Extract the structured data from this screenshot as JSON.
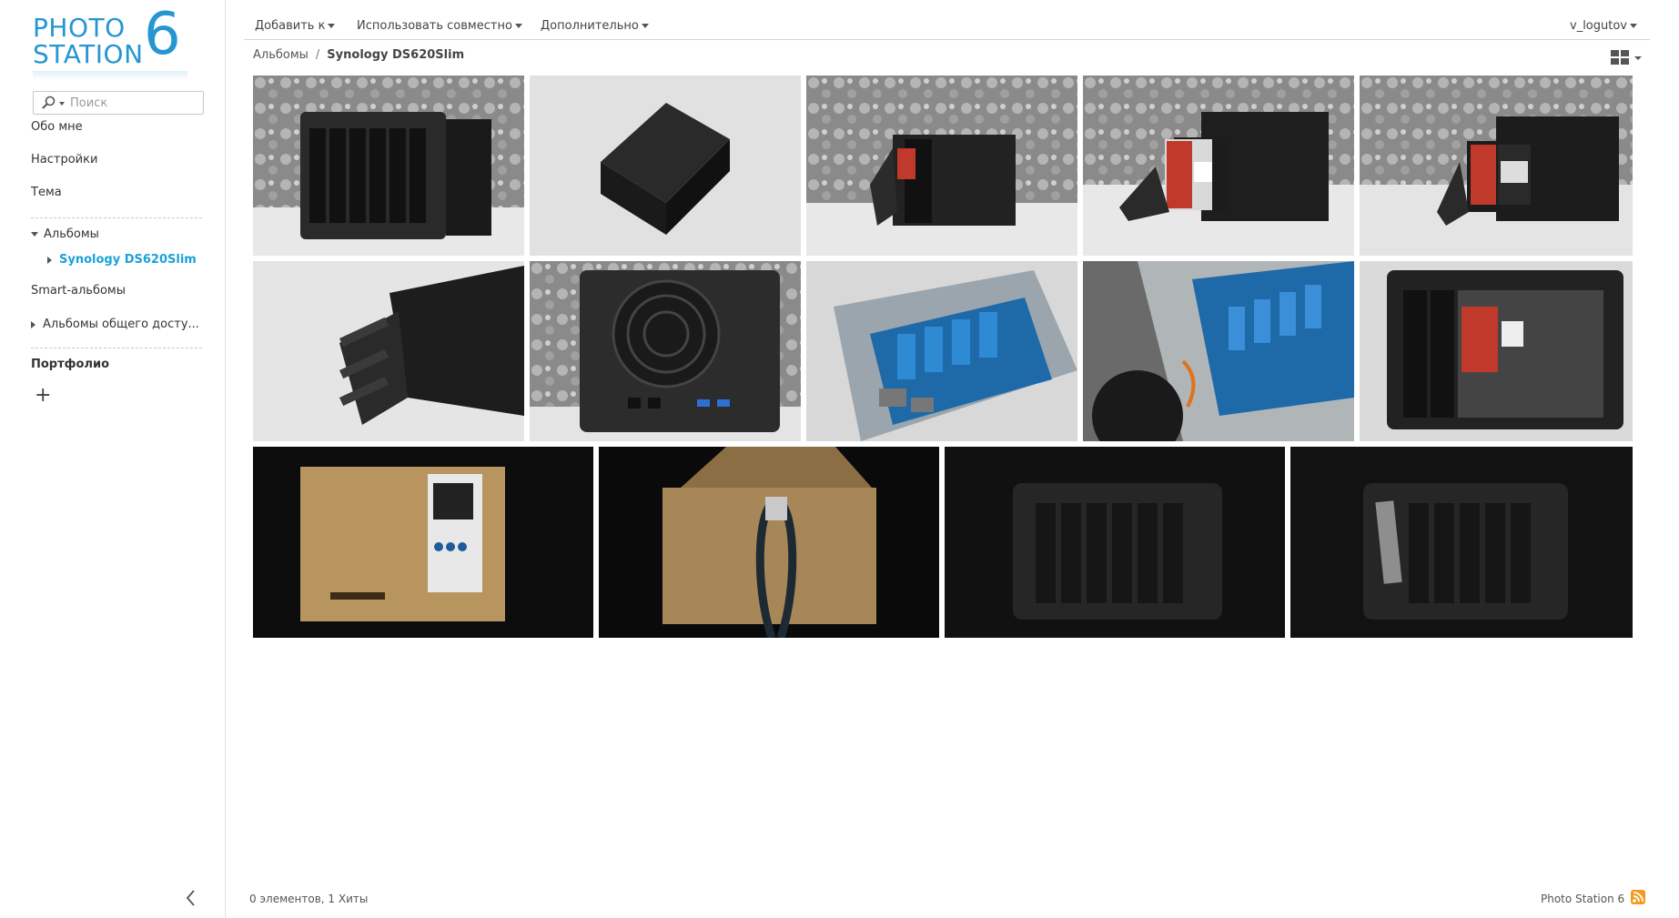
{
  "logo": {
    "line1": "PHOTO",
    "line2": "STATION",
    "version": "6"
  },
  "search": {
    "placeholder": "Поиск"
  },
  "sidebar": {
    "about": "Обо мне",
    "settings": "Настройки",
    "theme": "Тема",
    "albums": "Альбомы",
    "current_album": "Synology DS620Slim",
    "smart_albums": "Smart-альбомы",
    "shared_albums": "Альбомы общего досту...",
    "portfolio": "Портфолио",
    "add_symbol": "+"
  },
  "toolbar": {
    "add_to": "Добавить к",
    "share": "Использовать совместно",
    "more": "Дополнительно",
    "user": "v_logutov"
  },
  "breadcrumb": {
    "root": "Альбомы",
    "separator": "/",
    "current": "Synology DS620Slim"
  },
  "photos": [
    {
      "subject": "nas-front-wallpaper",
      "row": 1
    },
    {
      "subject": "nas-top-white",
      "row": 1
    },
    {
      "subject": "nas-ssd-tray-wallpaper",
      "row": 1
    },
    {
      "subject": "kingston-ssd-tray",
      "row": 1
    },
    {
      "subject": "nas-with-ssd",
      "row": 1
    },
    {
      "subject": "drive-trays-closeup",
      "row": 2
    },
    {
      "subject": "nas-rear-fan",
      "row": 2
    },
    {
      "subject": "internal-board",
      "row": 2
    },
    {
      "subject": "internal-open",
      "row": 2
    },
    {
      "subject": "nas-front-ssd-installed",
      "row": 2
    },
    {
      "subject": "diskstation-box",
      "row": 3
    },
    {
      "subject": "box-cable",
      "row": 3
    },
    {
      "subject": "nas-dark-front",
      "row": 3
    },
    {
      "subject": "nas-dark-tray",
      "row": 3
    }
  ],
  "footer": {
    "stats": "0 элементов, 1 Хиты",
    "brand": "Photo Station 6"
  },
  "colors": {
    "accent": "#1ba1d8",
    "logo": "#2596d0",
    "rss": "#f39a1e"
  }
}
